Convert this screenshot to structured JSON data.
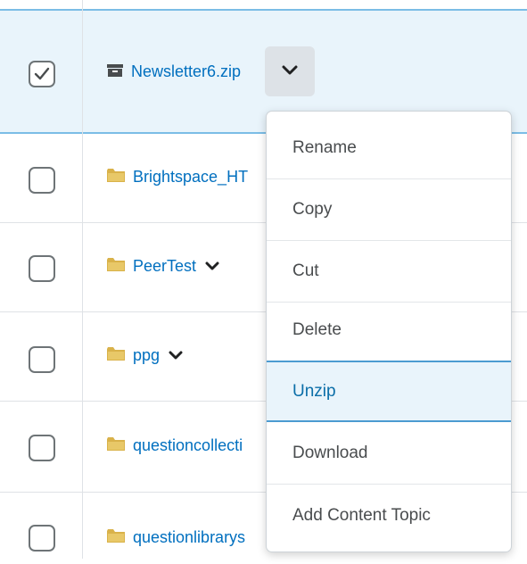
{
  "rows": [
    {
      "name": "Newsletter6.zip",
      "type": "zip",
      "checked": true,
      "has_menu": true
    },
    {
      "name": "Brightspace_HT",
      "type": "folder",
      "checked": false,
      "has_menu": false
    },
    {
      "name": "PeerTest",
      "type": "folder",
      "checked": false,
      "has_menu": true
    },
    {
      "name": "ppg",
      "type": "folder",
      "checked": false,
      "has_menu": true
    },
    {
      "name": "questioncollecti",
      "type": "folder",
      "checked": false,
      "has_menu": false
    },
    {
      "name": "questionlibrarys",
      "type": "folder",
      "checked": false,
      "has_menu": false
    }
  ],
  "context_menu": {
    "items": [
      "Rename",
      "Copy",
      "Cut",
      "Delete",
      "Unzip",
      "Download",
      "Add Content Topic"
    ],
    "active_item": "Unzip"
  },
  "colors": {
    "link": "#006fbf",
    "selected_row_bg": "#e9f4fb",
    "folder_icon": "#d9b24a",
    "zip_icon": "#494c4e"
  }
}
